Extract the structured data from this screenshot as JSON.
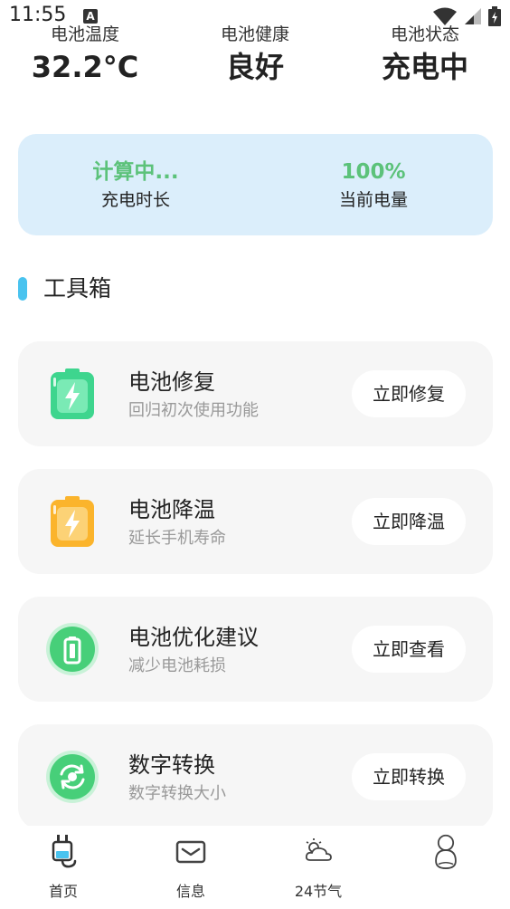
{
  "status_bar": {
    "time": "11:55",
    "notification_letter": "A"
  },
  "stats": [
    {
      "label": "电池温度",
      "value": "32.2°C"
    },
    {
      "label": "电池健康",
      "value": "良好"
    },
    {
      "label": "电池状态",
      "value": "充电中"
    }
  ],
  "charge_card": {
    "time_value": "计算中...",
    "time_label": "充电时长",
    "level_value": "100%",
    "level_label": "当前电量"
  },
  "section": {
    "title": "工具箱",
    "accent_color": "#49c3ef"
  },
  "tools": [
    {
      "title": "电池修复",
      "subtitle": "回归初次使用功能",
      "button": "立即修复",
      "icon": "green-battery-bolt-icon"
    },
    {
      "title": "电池降温",
      "subtitle": "延长手机寿命",
      "button": "立即降温",
      "icon": "orange-battery-bolt-icon"
    },
    {
      "title": "电池优化建议",
      "subtitle": "减少电池耗损",
      "button": "立即查看",
      "icon": "battery-circle-icon"
    },
    {
      "title": "数字转换",
      "subtitle": "数字转换大小",
      "button": "立即转换",
      "icon": "convert-circle-icon"
    }
  ],
  "nav": [
    {
      "label": "首页",
      "icon": "charger-plug-icon"
    },
    {
      "label": "信息",
      "icon": "mail-icon"
    },
    {
      "label": "24节气",
      "icon": "weather-cloud-icon"
    },
    {
      "label": "",
      "icon": "profile-icon"
    }
  ],
  "colors": {
    "green": "#5cc27a",
    "card_bg": "#dbeefb",
    "tool_bg": "#f6f6f6"
  }
}
